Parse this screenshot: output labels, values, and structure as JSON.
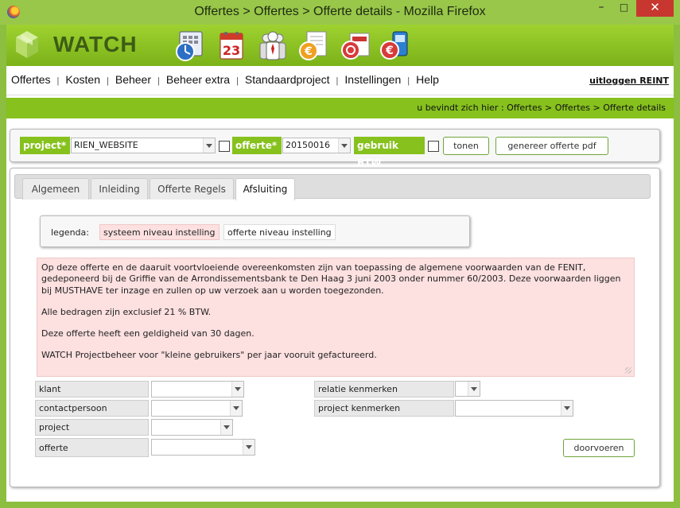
{
  "window": {
    "title": "Offertes > Offertes > Offerte details - Mozilla Firefox"
  },
  "header": {
    "logo_text": "WATCH"
  },
  "menu": {
    "items": [
      "Offertes",
      "Kosten",
      "Beheer",
      "Beheer extra",
      "Standaardproject",
      "Instellingen",
      "Help"
    ],
    "logout": "uitloggen REINT"
  },
  "breadcrumb": "u bevindt zich hier : Offertes > Offertes > Offerte details",
  "toolbar": {
    "project_label": "project*",
    "project_value": "RIEN_WEBSITE",
    "offerte_label": "offerte*",
    "offerte_value": "20150016",
    "btw_label": "gebruik BTW",
    "tonen_button": "tonen",
    "pdf_button": "genereer offerte pdf"
  },
  "tabs": [
    "Algemeen",
    "Inleiding",
    "Offerte Regels",
    "Afsluiting"
  ],
  "active_tab": "Afsluiting",
  "legend": {
    "label": "legenda:",
    "system": "systeem niveau instelling",
    "offerte": "offerte niveau instelling"
  },
  "closing_text": [
    "Op deze offerte en de daaruit voortvloeiende overeenkomsten zijn van toepassing de algemene voorwaarden van de FENIT, gedeponeerd bij de Griffie van de Arrondissementsbank te Den Haag 3 juni 2003 onder nummer 60/2003. Deze voorwaarden liggen bij MUSTHAVE ter inzage en zullen op uw verzoek aan u worden toegezonden.",
    "Alle bedragen zijn exclusief 21 % BTW.",
    "Deze offerte heeft een geldigheid van 30 dagen.",
    "WATCH Projectbeheer voor \"kleine gebruikers\" per jaar vooruit gefactureerd."
  ],
  "form": {
    "left": [
      "klant",
      "contactpersoon",
      "project",
      "offerte"
    ],
    "right": [
      "relatie kenmerken",
      "project kenmerken"
    ],
    "apply_button": "doorvoeren"
  },
  "colors": {
    "accent": "#86c11d",
    "pink": "#fde0e0",
    "close": "#c7372f"
  }
}
